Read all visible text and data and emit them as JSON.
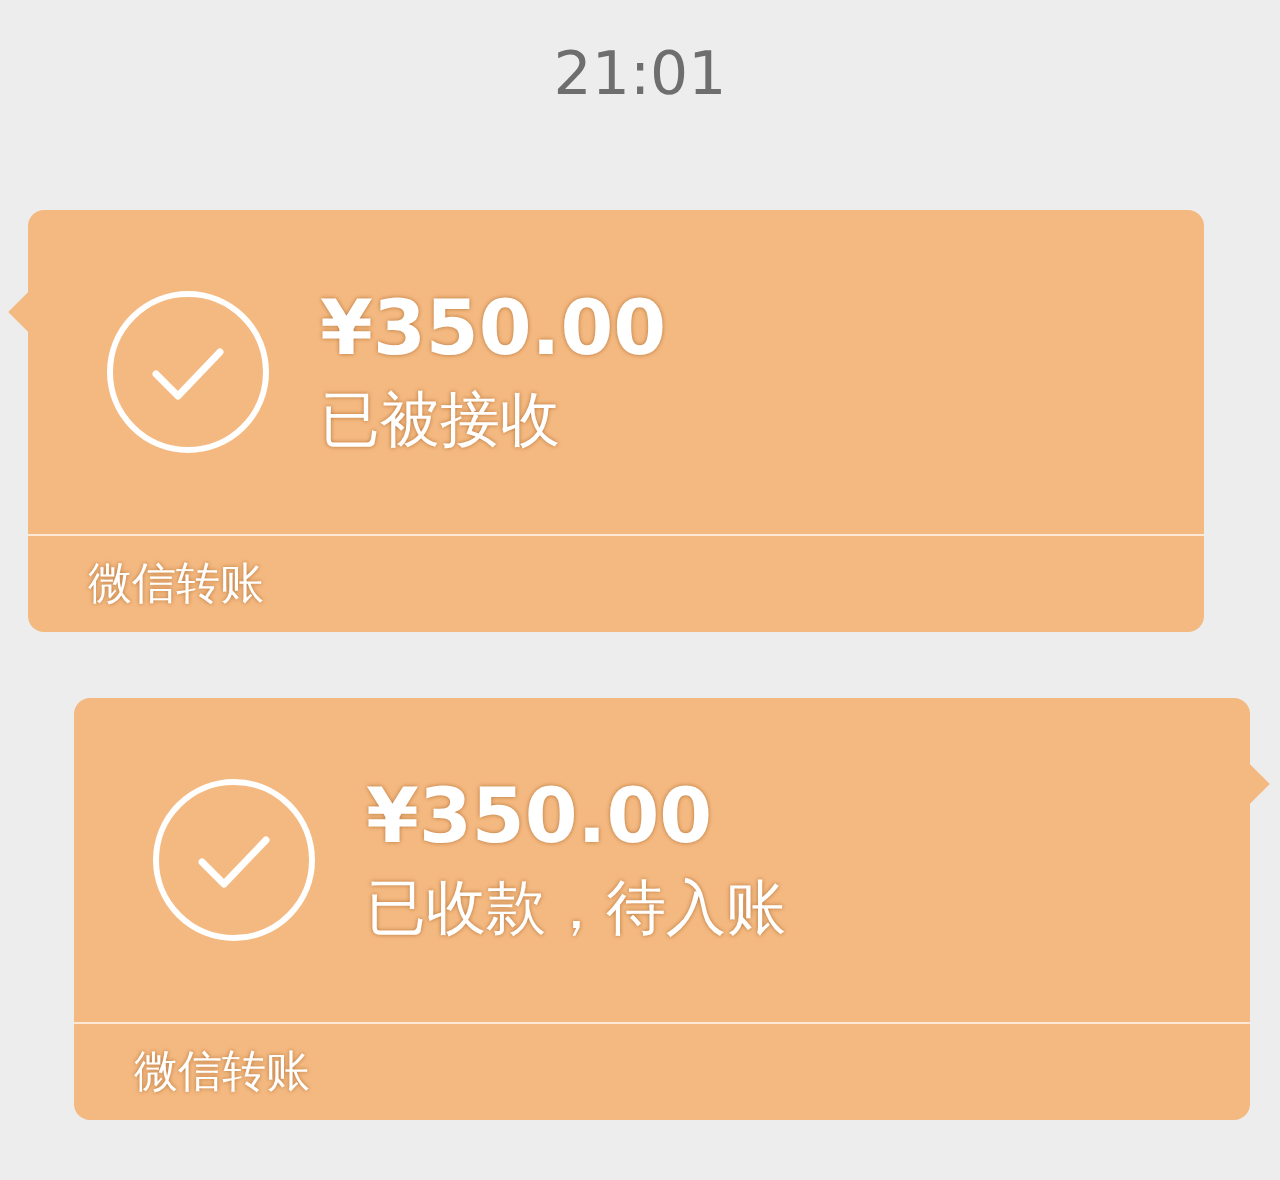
{
  "timestamp": "21:01",
  "messages": [
    {
      "kind": "incoming",
      "amount": "¥350.00",
      "status": "已被接收",
      "footer": "微信转账"
    },
    {
      "kind": "outgoing",
      "amount": "¥350.00",
      "status": "已收款，待入账",
      "footer": "微信转账"
    }
  ]
}
